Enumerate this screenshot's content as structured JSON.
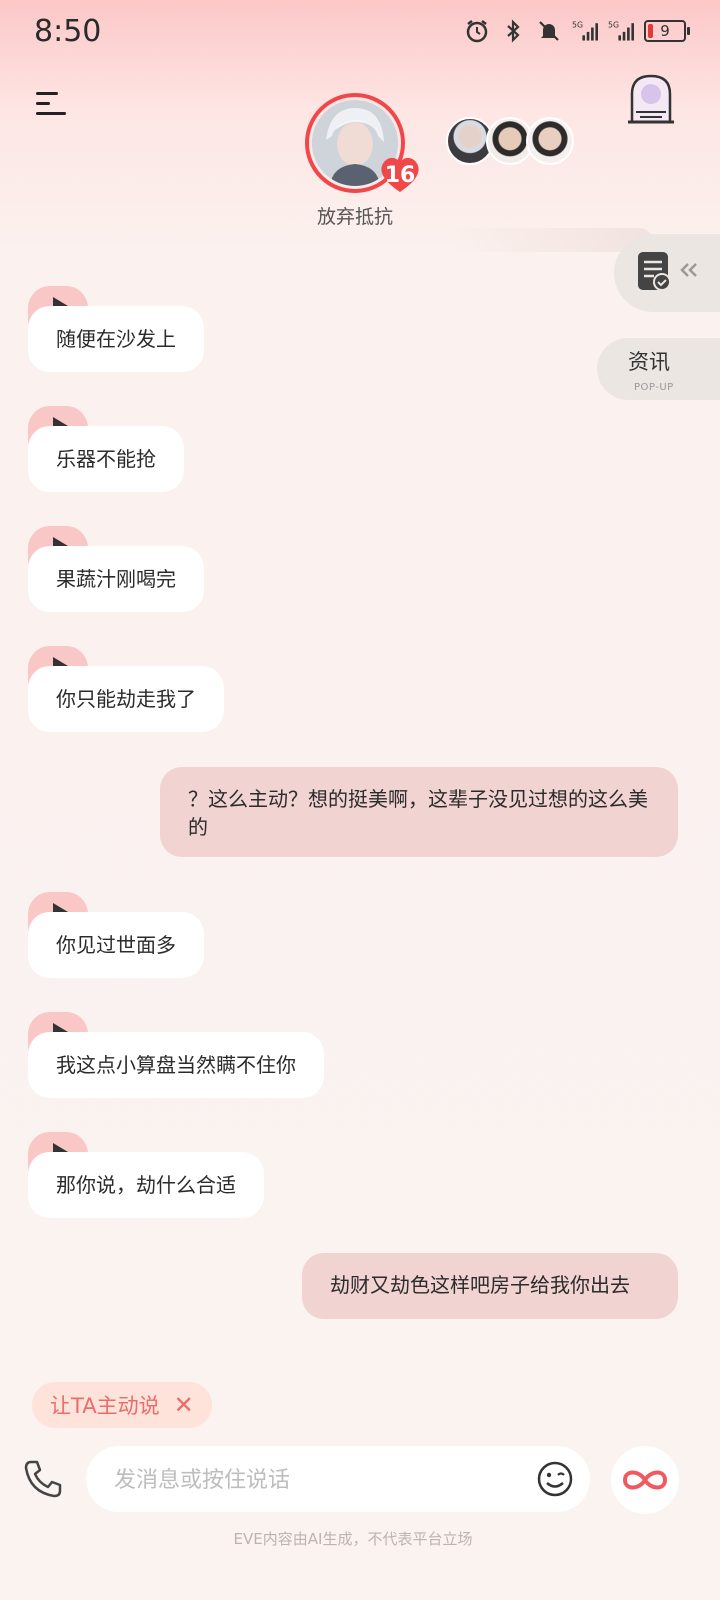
{
  "status_bar": {
    "time": "8:50",
    "battery": "9",
    "icons": [
      "alarm-icon",
      "bluetooth-icon",
      "mute-icon",
      "signal-5g-icon",
      "signal-5g-icon",
      "battery-icon"
    ]
  },
  "header": {
    "menu_icon": "menu-icon",
    "character_name": "放弃抵抗",
    "affinity_level": "16",
    "story_icon": "story-gate-icon"
  },
  "side_panel": {
    "memo_icon": "memo-check-icon",
    "news_label": "资讯",
    "news_sub": "POP-UP"
  },
  "messages": [
    {
      "type": "in",
      "text": "随便在沙发上"
    },
    {
      "type": "in",
      "text": "乐器不能抢"
    },
    {
      "type": "in",
      "text": "果蔬汁刚喝完"
    },
    {
      "type": "in",
      "text": "你只能劫走我了"
    },
    {
      "type": "out",
      "text": "？这么主动？想的挺美啊，这辈子没见过想的这么美的"
    },
    {
      "type": "in",
      "text": "你见过世面多"
    },
    {
      "type": "in",
      "text": "我这点小算盘当然瞒不住你"
    },
    {
      "type": "in",
      "text": "那你说，劫什么合适"
    },
    {
      "type": "out",
      "text": "劫财又劫色这样吧房子给我你出去"
    }
  ],
  "chip": {
    "label": "让TA主动说",
    "close": "✕"
  },
  "input": {
    "placeholder": "发消息或按住说话"
  },
  "footer_note": "EVE内容由AI生成，不代表平台立场",
  "colors": {
    "accent": "#f0474b",
    "bubble_out": "#f1d3d1",
    "play_tab": "#f9c7c5"
  }
}
